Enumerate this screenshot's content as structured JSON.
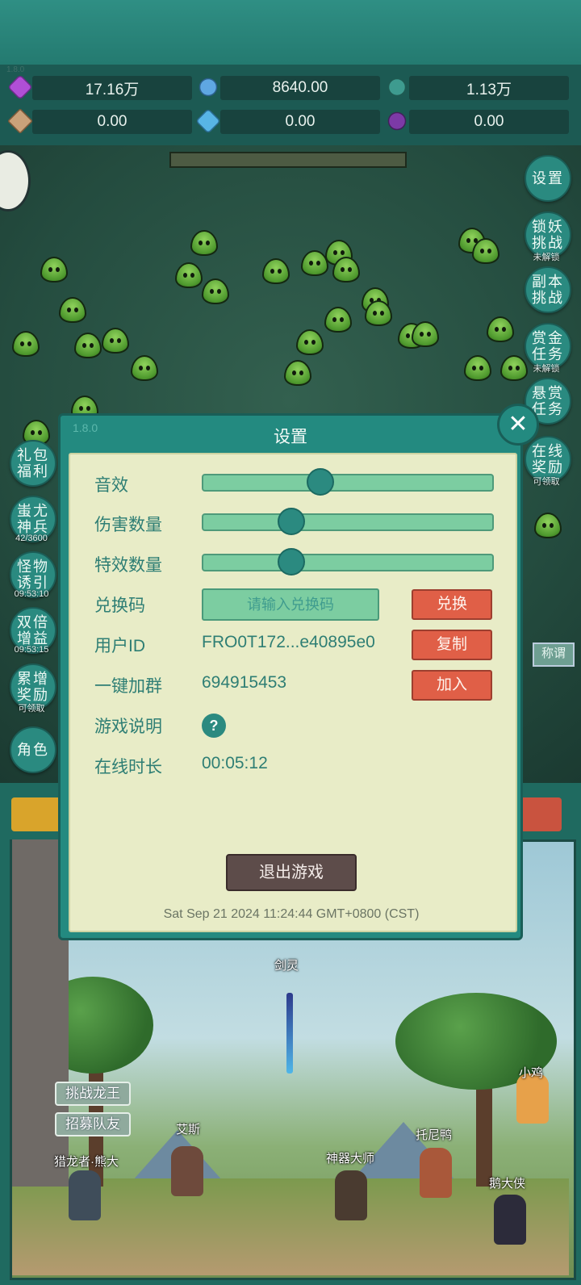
{
  "app": {
    "version_top": "1.8.0"
  },
  "resources": [
    {
      "icon": "purple-gem-icon",
      "color": "#b04fd6",
      "value": "17.16万"
    },
    {
      "icon": "blue-crystal-icon",
      "color": "#5fa7e2",
      "value": "8640.00"
    },
    {
      "icon": "green-orb-icon",
      "color": "#3e9b8f",
      "value": "1.13万"
    },
    {
      "icon": "scroll-icon",
      "color": "#c9a27a",
      "value": "0.00"
    },
    {
      "icon": "ice-shard-icon",
      "color": "#58b5e6",
      "value": "0.00"
    },
    {
      "icon": "purple-pot-icon",
      "color": "#7c3aa6",
      "value": "0.00"
    }
  ],
  "right_buttons": [
    {
      "label": "设置",
      "sub": ""
    },
    {
      "label": "锁妖挑战",
      "sub": "未解锁"
    },
    {
      "label": "副本挑战",
      "sub": ""
    },
    {
      "label": "赏金任务",
      "sub": "未解锁"
    },
    {
      "label": "悬赏任务",
      "sub": ""
    },
    {
      "label": "在线奖励",
      "sub": "可领取"
    }
  ],
  "left_buttons": [
    {
      "label": "礼包福利",
      "sub": ""
    },
    {
      "label": "蚩尤神兵",
      "sub": "42/3600"
    },
    {
      "label": "怪物诱引",
      "sub": "09:53:10"
    },
    {
      "label": "双倍增益",
      "sub": "09:53:15"
    },
    {
      "label": "累增奖励",
      "sub": "可领取"
    },
    {
      "label": "角色",
      "sub": ""
    }
  ],
  "side_tag": "称谓",
  "dialog": {
    "version": "1.8.0",
    "title": "设置",
    "sound_label": "音效",
    "sound_level": 0.4,
    "damage_label": "伤害数量",
    "damage_level": 0.3,
    "effects_label": "特效数量",
    "effects_level": 0.3,
    "redeem_label": "兑换码",
    "redeem_placeholder": "请输入兑换码",
    "redeem_button": "兑换",
    "userid_label": "用户ID",
    "userid_value": "FRO0T172...e40895e0",
    "copy_button": "复制",
    "group_label": "一键加群",
    "group_value": "694915453",
    "join_button": "加入",
    "guide_label": "游戏说明",
    "help_symbol": "?",
    "online_label": "在线时长",
    "online_value": "00:05:12",
    "exit_button": "退出游戏",
    "datetime": "Sat Sep 21 2024 11:24:44 GMT+0800 (CST)",
    "close_symbol": "✕"
  },
  "scene": {
    "challenge_button": "挑战龙王",
    "recruit_button": "招募队友",
    "npcs": [
      {
        "name": "剑灵"
      },
      {
        "name": "小鸡"
      },
      {
        "name": "艾斯"
      },
      {
        "name": "托尼鸭"
      },
      {
        "name": "猎龙者·熊大"
      },
      {
        "name": "神器大师"
      },
      {
        "name": "鹅大侠"
      }
    ]
  }
}
